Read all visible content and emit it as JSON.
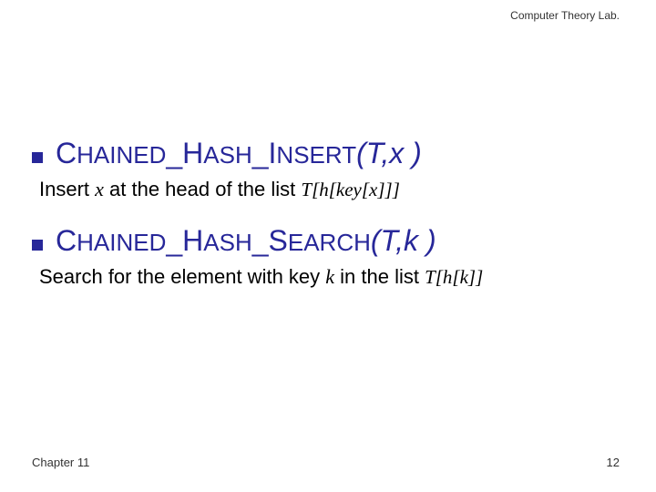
{
  "header": {
    "lab": "Computer Theory Lab."
  },
  "items": [
    {
      "func_prefix": "C",
      "func_mid1": "HAINED",
      "func_sep": "_H",
      "func_mid2": "ASH",
      "func_sep2": "_I",
      "func_mid3": "NSERT",
      "params": "(T,x )",
      "desc_pre": "Insert ",
      "desc_var1": "x",
      "desc_mid": " at the head of the list ",
      "desc_expr": "T[h[key[x]]]"
    },
    {
      "func_prefix": "C",
      "func_mid1": "HAINED",
      "func_sep": "_H",
      "func_mid2": "ASH",
      "func_sep2": "_S",
      "func_mid3": "EARCH",
      "params": "(T,k )",
      "desc_pre": "Search for the element with key ",
      "desc_var1": "k",
      "desc_mid": " in the list ",
      "desc_expr": "T[h[k]]"
    }
  ],
  "footer": {
    "chapter": "Chapter 11",
    "page": "12"
  }
}
